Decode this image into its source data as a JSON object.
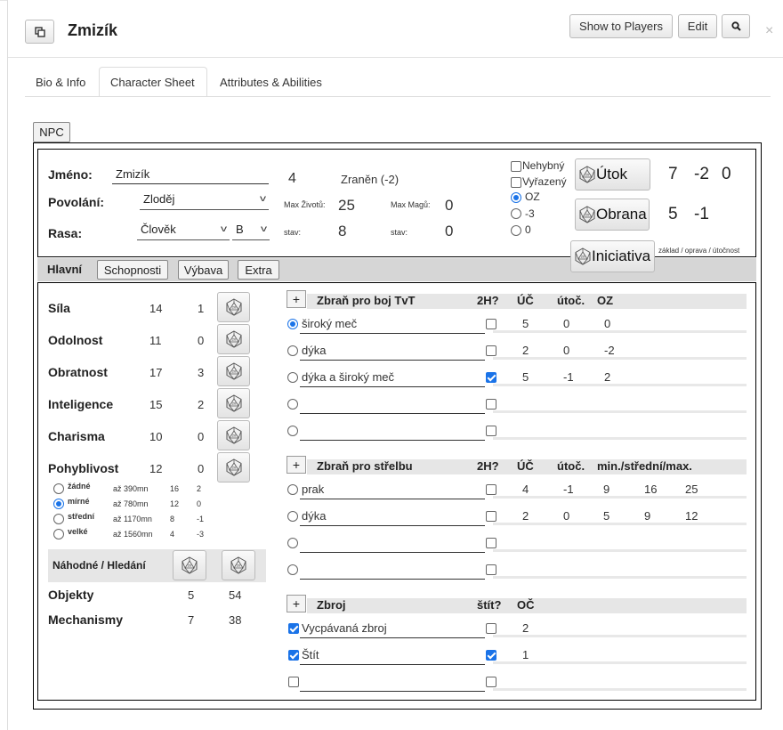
{
  "header": {
    "title": "Zmizík",
    "show_players": "Show to Players",
    "edit": "Edit"
  },
  "tabs": [
    "Bio & Info",
    "Character Sheet",
    "Attributes & Abilities"
  ],
  "npc_label": "NPC",
  "top": {
    "jmeno_label": "Jméno:",
    "jmeno": "Zmizík",
    "level": "4",
    "zraneni": "Zraněn (-2)",
    "povolani_label": "Povolání:",
    "povolani": "Zloděj",
    "max_zivotu_label": "Max Životů:",
    "max_zivotu": "25",
    "max_magu_label": "Max Magů:",
    "max_magu": "0",
    "rasa_label": "Rasa:",
    "rasa": "Člověk",
    "rasa_class": "B",
    "stav_label": "stav:",
    "stav_zivotu": "8",
    "stav_magu": "0",
    "status": {
      "nehybny": "Nehybný",
      "vyrazeny": "Vyřazený",
      "oz": "OZ",
      "m3": "-3",
      "zero": "0"
    },
    "utok": "Útok",
    "utok_vals": [
      "7",
      "-2",
      "0"
    ],
    "obrana": "Obrana",
    "obrana_vals": [
      "5",
      "-1"
    ],
    "iniciativa": "Iniciativa",
    "legend": "základ / oprava / útočnost"
  },
  "subtabs": {
    "hlavni": "Hlavní",
    "schopnosti": "Schopnosti",
    "vybava": "Výbava",
    "extra": "Extra"
  },
  "attributes": [
    {
      "name": "Síla",
      "value": "14",
      "bonus": "1"
    },
    {
      "name": "Odolnost",
      "value": "11",
      "bonus": "0"
    },
    {
      "name": "Obratnost",
      "value": "17",
      "bonus": "3"
    },
    {
      "name": "Inteligence",
      "value": "15",
      "bonus": "2"
    },
    {
      "name": "Charisma",
      "value": "10",
      "bonus": "0"
    },
    {
      "name": "Pohyblivost",
      "value": "12",
      "bonus": "0"
    }
  ],
  "load": [
    {
      "name": "žádné",
      "limit": "až 390mn",
      "a": "16",
      "b": "2"
    },
    {
      "name": "mírné",
      "limit": "až 780mn",
      "a": "12",
      "b": "0"
    },
    {
      "name": "střední",
      "limit": "až 1170mn",
      "a": "8",
      "b": "-1"
    },
    {
      "name": "velké",
      "limit": "až 1560mn",
      "a": "4",
      "b": "-3"
    }
  ],
  "search": {
    "title": "Náhodné / Hledání",
    "rows": [
      {
        "name": "Objekty",
        "a": "5",
        "b": "54"
      },
      {
        "name": "Mechanismy",
        "a": "7",
        "b": "38"
      }
    ]
  },
  "melee": {
    "title": "Zbraň pro boj TvT",
    "cols": [
      "2H?",
      "ÚČ",
      "útoč.",
      "OZ"
    ],
    "rows": [
      {
        "name": "široký meč",
        "uc": "5",
        "utoc": "0",
        "oz": "0"
      },
      {
        "name": "dýka",
        "uc": "2",
        "utoc": "0",
        "oz": "-2"
      },
      {
        "name": "dýka a široký meč",
        "uc": "5",
        "utoc": "-1",
        "oz": "2"
      }
    ]
  },
  "ranged": {
    "title": "Zbraň pro střelbu",
    "cols": [
      "2H?",
      "ÚČ",
      "útoč.",
      "min./střední/max."
    ],
    "rows": [
      {
        "name": "prak",
        "uc": "4",
        "utoc": "-1",
        "min": "9",
        "mid": "16",
        "max": "25"
      },
      {
        "name": "dýka",
        "uc": "2",
        "utoc": "0",
        "min": "5",
        "mid": "9",
        "max": "12"
      }
    ]
  },
  "armor": {
    "title": "Zbroj",
    "cols": [
      "štít?",
      "OČ"
    ],
    "rows": [
      {
        "name": "Vycpávaná zbroj",
        "oc": "2"
      },
      {
        "name": "Štít",
        "oc": "1"
      }
    ]
  }
}
